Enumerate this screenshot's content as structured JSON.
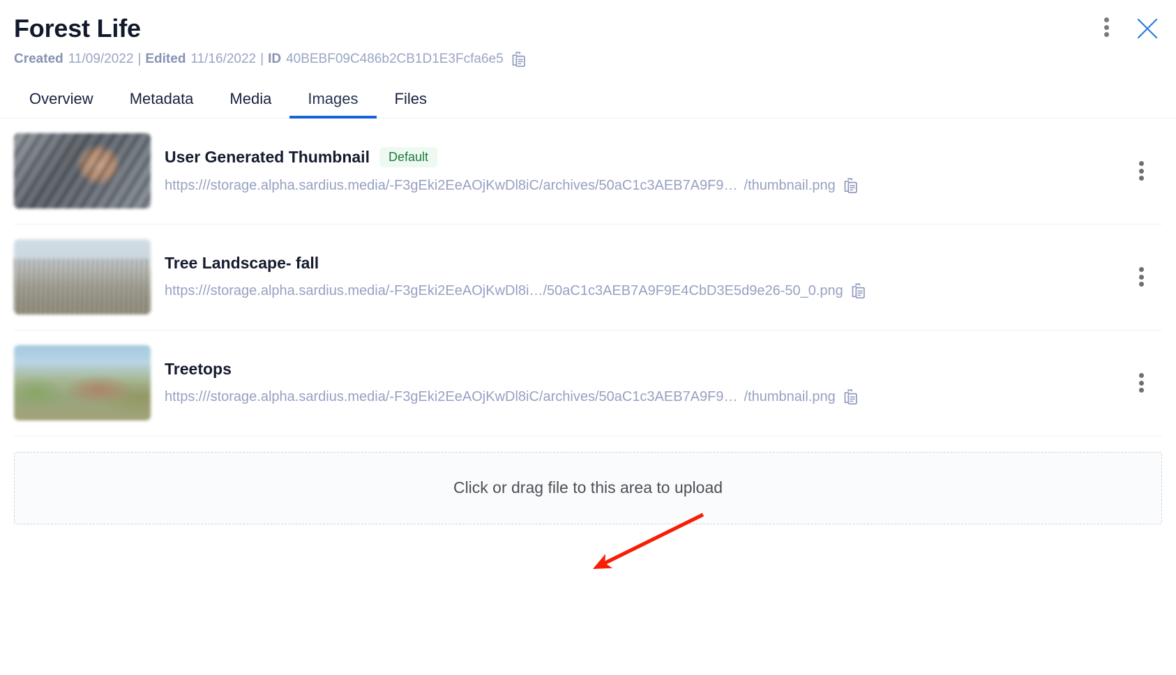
{
  "header": {
    "title": "Forest Life",
    "meta": {
      "created_label": "Created",
      "created_value": "11/09/2022",
      "separator": "|",
      "edited_label": "Edited",
      "edited_value": "11/16/2022",
      "id_label": "ID",
      "id_value": "40BEBF09C486b2CB1D1E3Fcfa6e5",
      "copy_icon": "copy-clipboard-icon"
    },
    "controls": {
      "more_icon": "kebab-menu-icon",
      "close_icon": "close-x-icon",
      "close_color": "#1565d8"
    }
  },
  "tabs": {
    "items": [
      {
        "label": "Overview",
        "active": false
      },
      {
        "label": "Metadata",
        "active": false
      },
      {
        "label": "Media",
        "active": false
      },
      {
        "label": "Images",
        "active": true
      },
      {
        "label": "Files",
        "active": false
      }
    ],
    "active_color": "#1565d8"
  },
  "images": {
    "rows": [
      {
        "title": "User Generated Thumbnail",
        "badge": "Default",
        "badge_color": "#1d7a3c",
        "badge_bg": "#eefaf1",
        "url_main": "https:///storage.alpha.sardius.media/-F3gEki2EeAOjKwDl8iC/archives/50aC1c3AEB7A9F9…",
        "url_tail": "/thumbnail.png",
        "copy_icon": "copy-clipboard-icon",
        "menu_icon": "kebab-menu-icon",
        "thumb_alt": "blurred close-up of pine cone on charred bark"
      },
      {
        "title": "Tree Landscape- fall",
        "badge": "",
        "url_main": "https:///storage.alpha.sardius.media/-F3gEki2EeAOjKwDl8i…/50aC1c3AEB7A9F9E4CbD3E5d9e26-50_0.png",
        "url_tail": "",
        "copy_icon": "copy-clipboard-icon",
        "menu_icon": "kebab-menu-icon",
        "thumb_alt": "blurred burned forest hillside"
      },
      {
        "title": "Treetops",
        "badge": "",
        "url_main": "https:///storage.alpha.sardius.media/-F3gEki2EeAOjKwDl8iC/archives/50aC1c3AEB7A9F9…",
        "url_tail": "/thumbnail.png",
        "copy_icon": "copy-clipboard-icon",
        "menu_icon": "kebab-menu-icon",
        "thumb_alt": "blurred green and autumn treetops"
      }
    ]
  },
  "upload": {
    "text": "Click or drag file to this area to upload"
  },
  "annotation": {
    "arrow_color": "#f71e05",
    "points_to": "upload-dropzone"
  }
}
